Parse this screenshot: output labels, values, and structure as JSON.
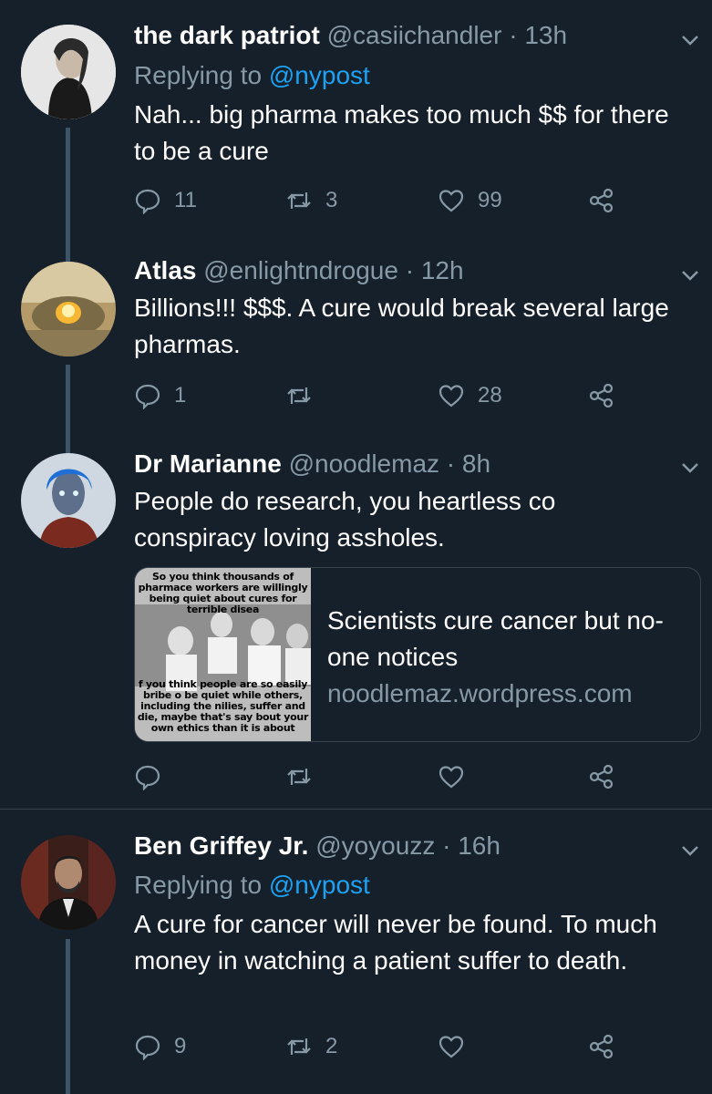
{
  "colors": {
    "background": "#15202b",
    "secondary_text": "#8899a6",
    "link": "#1da1f2",
    "line": "#3d5466"
  },
  "tweets": [
    {
      "name": "the dark patriot",
      "handle": "@casiichandler · 13h",
      "replying_prefix": "Replying to ",
      "replying_to": "@nypost",
      "text": "Nah... big pharma makes too much $$ for there to be a cure",
      "replies": "11",
      "retweets": "3",
      "likes": "99"
    },
    {
      "name": "Atlas",
      "handle": "@enlightndrogue · 12h",
      "text": "Billions!!!  $$$. A cure would break several large pharmas.",
      "replies": "1",
      "retweets": "",
      "likes": "28"
    },
    {
      "name": "Dr Marianne",
      "handle": "@noodlemaz · 8h",
      "text": "People do research, you heartless co conspiracy loving assholes.",
      "card": {
        "title": "Scientists cure cancer but no-one notices",
        "domain": "noodlemaz.wordpress.com",
        "meme_top": "So you think thousands of pharmace workers are willingly being quiet about cures for terrible disea",
        "meme_bottom": "f you think people are so easily bribe o be quiet while others, including the nilies, suffer and die, maybe that's say bout your own ethics than it is about"
      },
      "replies": "",
      "retweets": "",
      "likes": ""
    },
    {
      "name": "Ben Griffey Jr.",
      "handle": "@yoyouzz · 16h",
      "replying_prefix": "Replying to ",
      "replying_to": "@nypost",
      "text": "A cure for cancer will never be found. To much money in watching a patient suffer to death.",
      "replies": "9",
      "retweets": "2",
      "likes": ""
    }
  ]
}
